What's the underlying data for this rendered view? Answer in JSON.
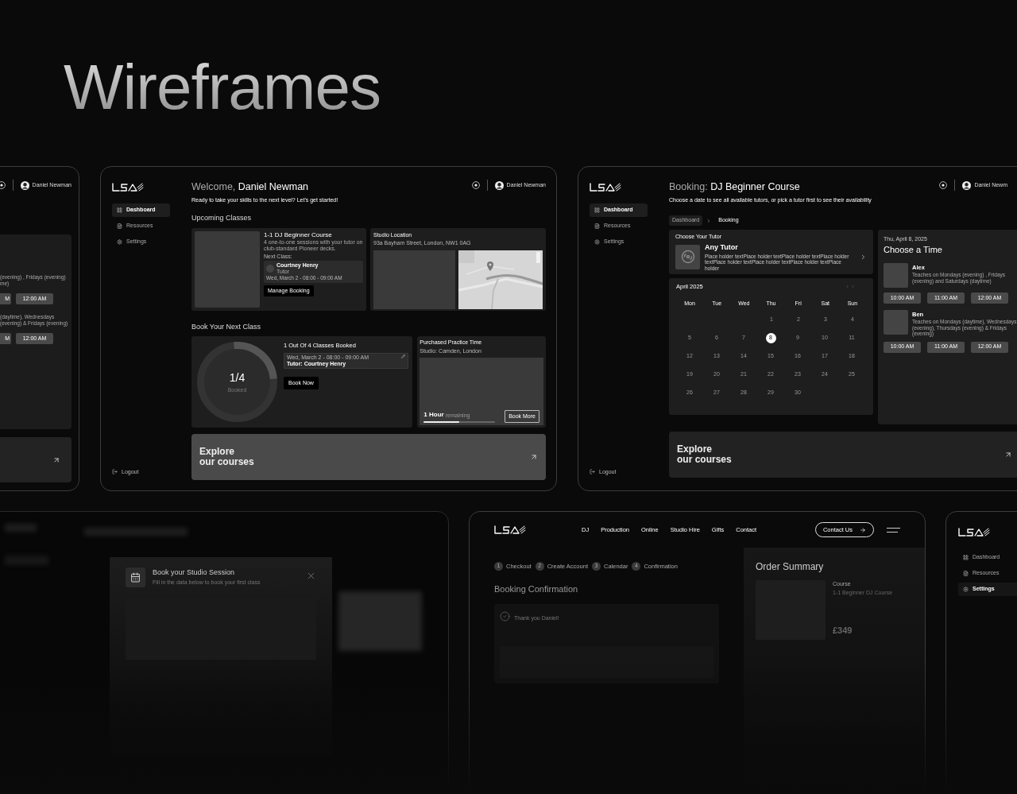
{
  "title": "Wireframes",
  "partial_booking": {
    "user": "Daniel Newman",
    "tutors": [
      {
        "lines": [
          "(evening) , Fridays (evening)",
          "me)"
        ],
        "times": [
          "M",
          "12:00 AM"
        ]
      },
      {
        "lines": [
          "(daytime), Wednesdays",
          "(evening) & Fridays (evening)"
        ],
        "times": [
          "M",
          "12:00 AM"
        ]
      }
    ]
  },
  "dashboard": {
    "user": "Daniel Newman",
    "nav": [
      {
        "label": "Dashboard",
        "selected": true
      },
      {
        "label": "Resources",
        "selected": false
      },
      {
        "label": "Settings",
        "selected": false
      }
    ],
    "logout": "Logout",
    "greeting": "Welcome, **Daniel Newman**",
    "subtitle": "Ready to take your skills to the next level? Let's get started!",
    "upcoming_heading": "Upcoming Classes",
    "course": {
      "title": "1-1 DJ Beginner Course",
      "description": "4 one-to-one sessions with your tutor on club-standard Pioneer decks.",
      "next_label": "Next Class:",
      "tutor": "Courtney Henry",
      "tutor_role": "Tutor",
      "time": "Wed, March 2 - 08:00 - 09:00 AM",
      "button": "Manage Booking"
    },
    "studio": {
      "title": "Studio Location",
      "address": "93a Bayham Street, London, NW1 0AG"
    },
    "book_heading": "Book Your Next Class",
    "progress": {
      "count": "1/4",
      "caption": "Booked",
      "level": 0.25,
      "title": "1 Out Of 4 Classes Booked",
      "booking_time": "Wed, March 2 - 08:00 - 09:00 AM",
      "booking_tutor": "Tutor: Courtney Henry",
      "button": "Book Now"
    },
    "practice": {
      "title": "Purchased Practice Time",
      "studio": "Studio: Camden, London",
      "amount": "1 Hour",
      "amount_caption": "remaining",
      "level": 0.5,
      "button": "Book More"
    },
    "explore": [
      "Explore",
      "our courses"
    ]
  },
  "booking": {
    "user": "Daniel Newm",
    "nav": [
      {
        "label": "Dashboard",
        "selected": true
      },
      {
        "label": "Resources",
        "selected": false
      },
      {
        "label": "Settings",
        "selected": false
      }
    ],
    "logout": "Logout",
    "heading": "Booking: **DJ Beginner Course**",
    "subtitle": "Choose a date to see all available tutors, or pick a tutor first to see their availability",
    "breadcrumbs": [
      {
        "label": "Dashboard",
        "selected": false
      },
      {
        "label": "Booking",
        "selected": true
      }
    ],
    "tutor_card": {
      "title": "Choose Your Tutor",
      "name": "Any Tutor",
      "description": "Place holder textPlace holder textPlace holder textPlace holder textPlace holder textPlace holder textPlace holder textPlace holder"
    },
    "calendar": {
      "month": "April 2025",
      "weekdays": [
        "Mon",
        "Tue",
        "Wed",
        "Thu",
        "Fri",
        "Sat",
        "Sun"
      ],
      "weeks": [
        [
          {
            "label": "1",
            "selected": false
          },
          {
            "label": "2",
            "selected": false
          },
          {
            "label": "3",
            "selected": false
          },
          {
            "label": "4",
            "selected": false
          }
        ],
        [
          {
            "label": "5",
            "selected": false
          },
          {
            "label": "6",
            "selected": false
          },
          {
            "label": "7",
            "selected": false
          },
          {
            "label": "8",
            "selected": true
          },
          {
            "label": "9",
            "selected": false
          },
          {
            "label": "10",
            "selected": false
          },
          {
            "label": "11",
            "selected": false
          }
        ],
        [
          {
            "label": "12",
            "selected": false
          },
          {
            "label": "13",
            "selected": false
          },
          {
            "label": "14",
            "selected": false
          },
          {
            "label": "15",
            "selected": false
          },
          {
            "label": "16",
            "selected": false
          },
          {
            "label": "17",
            "selected": false
          },
          {
            "label": "18",
            "selected": false
          }
        ],
        [
          {
            "label": "19",
            "selected": false
          },
          {
            "label": "20",
            "selected": false
          },
          {
            "label": "21",
            "selected": false
          },
          {
            "label": "22",
            "selected": false
          },
          {
            "label": "23",
            "selected": false
          },
          {
            "label": "24",
            "selected": false
          },
          {
            "label": "25",
            "selected": false
          }
        ],
        [
          {
            "label": "26",
            "selected": false
          },
          {
            "label": "27",
            "selected": false
          },
          {
            "label": "28",
            "selected": false
          },
          {
            "label": "29",
            "selected": false
          },
          {
            "label": "30",
            "selected": false
          }
        ]
      ]
    },
    "times": {
      "date": "Thu, April 8, 2025",
      "title": "Choose a Time",
      "tutors": [
        {
          "name": "Alex",
          "description": "Teaches on Mondays (evening) , Fridays (evening) and Saturdays (daytime)",
          "times": [
            "10:00 AM",
            "11:00 AM",
            "12:00 AM"
          ]
        },
        {
          "name": "Ben",
          "description": "Teaches on Mondays (daytime), Wednesdays (evening), Thursdays (evening) & Fridays (evening)",
          "times": [
            "10:00 AM",
            "11:00 AM",
            "12:00 AM"
          ]
        }
      ]
    },
    "explore": [
      "Explore",
      "our courses"
    ]
  },
  "studio_modal": {
    "title": "Book your Studio Session",
    "subtitle": "Fill in the data below to book your first class"
  },
  "checkout": {
    "links": [
      "DJ",
      "Production",
      "Online",
      "Studio Hire",
      "Gifts",
      "Contact"
    ],
    "contact_button": "Contact Us",
    "steps": [
      {
        "number": "1",
        "label": "Checkout"
      },
      {
        "number": "2",
        "label": "Create Account"
      },
      {
        "number": "3",
        "label": "Calendar"
      },
      {
        "number": "4",
        "label": "Confirmation"
      }
    ],
    "heading": "Booking Confirmation",
    "thanks": "Thank you Daniel!",
    "summary": {
      "title": "Order Summary",
      "course_label": "Course",
      "course_name": "1-1 Beginner DJ Course",
      "price": "£349"
    }
  },
  "sidebar_preview": {
    "nav": [
      {
        "label": "Dashboard",
        "selected": false
      },
      {
        "label": "Resources",
        "selected": false
      },
      {
        "label": "Settings",
        "selected": true
      }
    ]
  }
}
